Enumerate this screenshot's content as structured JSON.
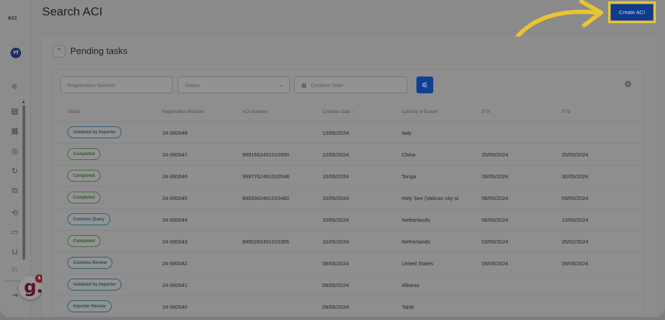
{
  "app": {
    "logo_text": "ACI",
    "user_initials": "YT",
    "page_title": "Search ACI",
    "create_button": "Create ACI",
    "notification_count": "6",
    "helper_letter": "g."
  },
  "sidebar": {
    "icons": [
      "sliders-icon",
      "document-icon",
      "document-list-icon",
      "globe-icon",
      "refresh-icon",
      "file-copy-icon",
      "link-icon",
      "chat-icon",
      "stamp-icon",
      "flag-icon",
      "logout-icon"
    ]
  },
  "pending": {
    "title": "Pending tasks",
    "filters": {
      "registration_placeholder": "Registration Number",
      "status_placeholder": "Status",
      "date_placeholder": "Creation Date"
    },
    "columns": [
      "Status",
      "Registration Number",
      "ACI Number",
      "Creation Date ↑",
      "Country of Export",
      "ETA",
      "ETD"
    ],
    "rows": [
      {
        "status": "Validated by Importer",
        "tone": "blue",
        "reg": "24-000048",
        "aci": "",
        "date": "13/05/2024",
        "country": "Italy",
        "eta": "",
        "etd": ""
      },
      {
        "status": "Completed",
        "tone": "green",
        "reg": "24-000047",
        "aci": "9991562401010590",
        "date": "12/05/2024",
        "country": "China",
        "eta": "25/06/2024",
        "etd": "25/05/2024"
      },
      {
        "status": "Completed",
        "tone": "green",
        "reg": "24-000046",
        "aci": "9997762401010548",
        "date": "10/05/2024",
        "country": "Tonga",
        "eta": "09/05/2024",
        "etd": "30/05/2024"
      },
      {
        "status": "Completed",
        "tone": "green",
        "reg": "24-000045",
        "aci": "9993362401010480",
        "date": "10/05/2024",
        "country": "Holy See (Vatican city st",
        "eta": "08/05/2024",
        "etd": "09/05/2024"
      },
      {
        "status": "Customs Query",
        "tone": "blue",
        "reg": "24-000044",
        "aci": "",
        "date": "10/05/2024",
        "country": "Netherlands",
        "eta": "06/05/2024",
        "etd": "10/05/2024"
      },
      {
        "status": "Completed",
        "tone": "green",
        "reg": "24-000043",
        "aci": "9995282401010355",
        "date": "10/05/2024",
        "country": "Netherlands",
        "eta": "03/05/2024",
        "etd": "25/02/2024"
      },
      {
        "status": "Customs Review",
        "tone": "blue",
        "reg": "24-000042",
        "aci": "",
        "date": "09/05/2024",
        "country": "United States",
        "eta": "09/05/2024",
        "etd": "09/05/2024"
      },
      {
        "status": "Validated by Importer",
        "tone": "blue",
        "reg": "24-000041",
        "aci": "",
        "date": "09/05/2024",
        "country": "Albania",
        "eta": "",
        "etd": ""
      },
      {
        "status": "Importer Review",
        "tone": "blue",
        "reg": "24-000040",
        "aci": "",
        "date": "09/05/2024",
        "country": "Tahiti",
        "eta": "",
        "etd": ""
      }
    ]
  },
  "colors": {
    "primary_button": "#103a8a",
    "highlight": "#e8c431",
    "completed": "#3f6d3a",
    "in_progress": "#2f5d72"
  }
}
